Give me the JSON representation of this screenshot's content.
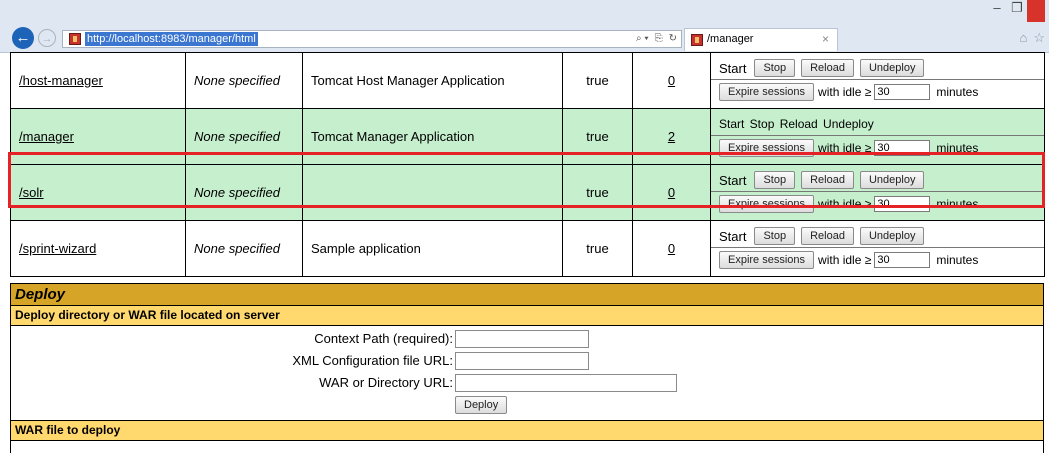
{
  "browser": {
    "url": "http://localhost:8983/manager/html",
    "tab_title": "/manager",
    "tab_close": "×",
    "address_tools": [
      "⌕ ▾",
      "⎘",
      "↻"
    ],
    "window_controls": [
      "–",
      "❐"
    ],
    "right_icons": [
      "⌂",
      "☆"
    ]
  },
  "apps": [
    {
      "path": "/host-manager",
      "display": "None specified",
      "description": "Tomcat Host Manager Application",
      "running": "true",
      "sessions": "0",
      "commands_style": "buttons",
      "highlighted": false,
      "row_color": "white"
    },
    {
      "path": "/manager",
      "display": "None specified",
      "description": "Tomcat Manager Application",
      "running": "true",
      "sessions": "2",
      "commands_style": "text",
      "highlighted": false,
      "row_color": "green"
    },
    {
      "path": "/solr",
      "display": "None specified",
      "description": "",
      "running": "true",
      "sessions": "0",
      "commands_style": "buttons",
      "highlighted": true,
      "row_color": "green"
    },
    {
      "path": "/sprint-wizard",
      "display": "None specified",
      "description": "Sample application",
      "running": "true",
      "sessions": "0",
      "commands_style": "buttons",
      "highlighted": false,
      "row_color": "white"
    }
  ],
  "commands": {
    "start": "Start",
    "stop": "Stop",
    "reload": "Reload",
    "undeploy": "Undeploy",
    "plain_text": "Start  Stop  Reload  Undeploy",
    "expire_sessions": "Expire sessions",
    "with_idle": "with idle ≥",
    "idle_value": "30",
    "minutes": "minutes"
  },
  "deploy": {
    "title": "Deploy",
    "server_section": "Deploy directory or WAR file located on server",
    "context_path_label": "Context Path (required):",
    "xml_config_label": "XML Configuration file URL:",
    "war_dir_label": "WAR or Directory URL:",
    "deploy_button": "Deploy",
    "war_section": "WAR file to deploy"
  },
  "colors": {
    "highlight_border": "#e52326",
    "green_row": "#c6efce",
    "deploy_header": "#d6a527",
    "subsection_header": "#ffd86e"
  }
}
